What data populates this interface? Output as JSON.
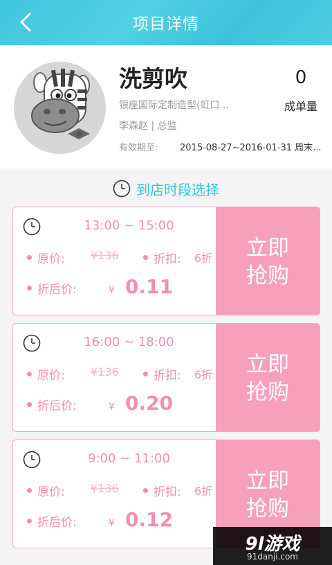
{
  "header": {
    "title": "项目详情"
  },
  "shop": {
    "name": "洗剪吹",
    "address": "银座国际定制造型(虹口...",
    "staff": "李森赵 | 总监",
    "valid_label": "有效期至:",
    "valid_value": "2015-08-27~2016-01-31 周末...",
    "sales_count": "0",
    "sales_label": "成单量"
  },
  "section": {
    "title": "到店时段选择"
  },
  "labels": {
    "original": "原价:",
    "discount": "折扣:",
    "after_discount": "折后价:",
    "yen": "¥",
    "buy_line1": "立即",
    "buy_line2": "抢购"
  },
  "slots": [
    {
      "time": "13:00 ~ 15:00",
      "original_price": "¥136",
      "discount": "6折",
      "final_price": "0.11"
    },
    {
      "time": "16:00 ~ 18:00",
      "original_price": "¥136",
      "discount": "6折",
      "final_price": "0.20"
    },
    {
      "time": "9:00 ~ 11:00",
      "original_price": "¥136",
      "discount": "6折",
      "final_price": "0.12"
    }
  ],
  "watermark": {
    "brand": "9l游戏",
    "url": "91danji.com"
  },
  "colors": {
    "accent": "#3cc4da",
    "pink": "#f28fb0",
    "button": "#f7a0bc"
  },
  "icons": {
    "back": "chevron-left-icon",
    "clock": "clock-icon",
    "avatar": "zebra-avatar"
  }
}
